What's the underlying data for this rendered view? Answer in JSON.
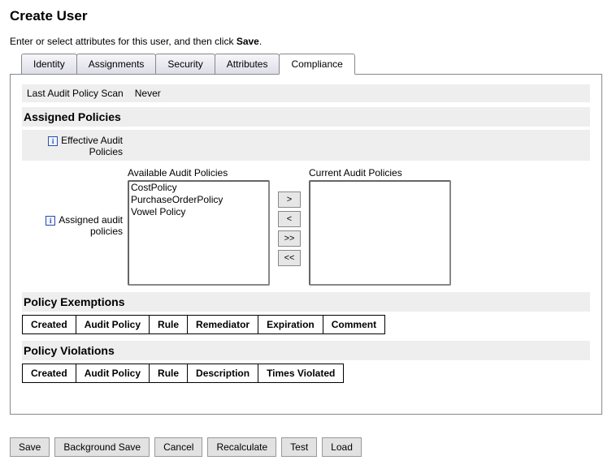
{
  "page": {
    "title": "Create User",
    "instructions_pre": "Enter or select attributes for this user, and then click ",
    "instructions_bold": "Save",
    "instructions_post": "."
  },
  "tabs": {
    "identity": "Identity",
    "assignments": "Assignments",
    "security": "Security",
    "attributes": "Attributes",
    "compliance": "Compliance"
  },
  "audit": {
    "last_scan_label": "Last Audit Policy Scan",
    "last_scan_value": "Never"
  },
  "sections": {
    "assigned_policies": "Assigned Policies",
    "effective_label": "Effective Audit Policies",
    "assigned_label": "Assigned audit policies",
    "available_caption": "Available Audit Policies",
    "current_caption": "Current Audit Policies",
    "policy_exemptions": "Policy Exemptions",
    "policy_violations": "Policy Violations"
  },
  "available_policies": {
    "0": "CostPolicy",
    "1": "PurchaseOrderPolicy",
    "2": "Vowel Policy"
  },
  "move_buttons": {
    "add": ">",
    "remove": "<",
    "add_all": ">>",
    "remove_all": "<<"
  },
  "exemptions_cols": {
    "0": "Created",
    "1": "Audit Policy",
    "2": "Rule",
    "3": "Remediator",
    "4": "Expiration",
    "5": "Comment"
  },
  "violations_cols": {
    "0": "Created",
    "1": "Audit Policy",
    "2": "Rule",
    "3": "Description",
    "4": "Times Violated"
  },
  "buttons": {
    "save": "Save",
    "bg_save": "Background Save",
    "cancel": "Cancel",
    "recalc": "Recalculate",
    "test": "Test",
    "load": "Load"
  }
}
